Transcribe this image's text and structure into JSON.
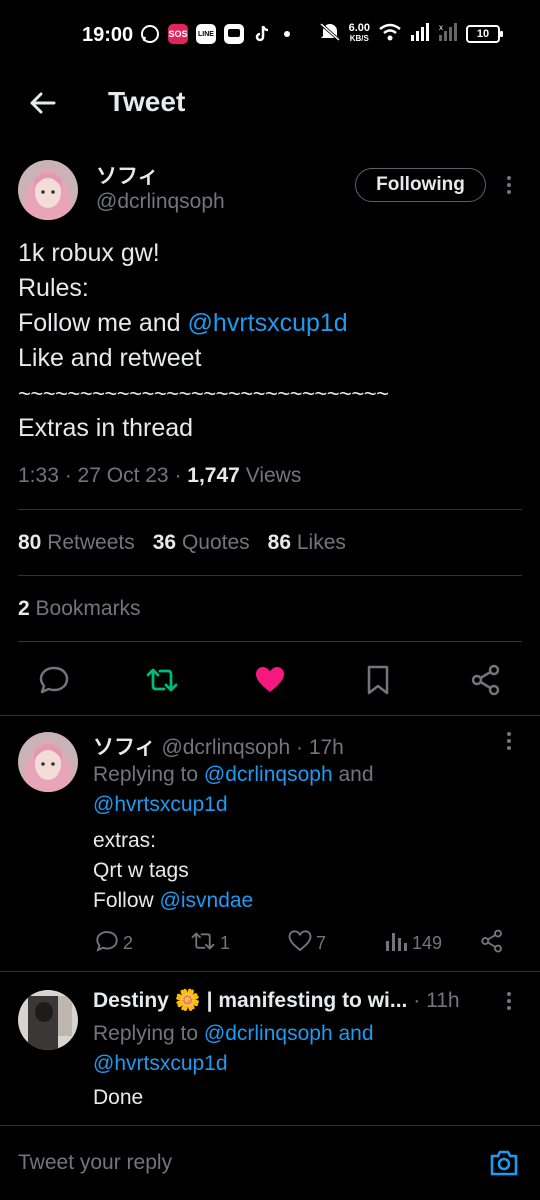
{
  "status_bar": {
    "time": "19:00",
    "net_speed_value": "6.00",
    "net_speed_unit": "KB/S",
    "battery": "10"
  },
  "header": {
    "title": "Tweet"
  },
  "main_tweet": {
    "author_name": "ソフィ",
    "author_handle": "@dcrlinqsoph",
    "follow_label": "Following",
    "lines": {
      "l1": "1k robux gw!",
      "l2": "Rules:",
      "l3_prefix": "Follow me and ",
      "l3_mention": "@hvrtsxcup1d",
      "l4": "Like and retweet",
      "l5": "~~~~~~~~~~~~~~~~~~~~~~~~~~~~~~",
      "l6": "Extras in thread"
    },
    "time": "1:33",
    "date": "27 Oct 23",
    "views_count": "1,747",
    "views_label": "Views",
    "retweets_count": "80",
    "retweets_label": "Retweets",
    "quotes_count": "36",
    "quotes_label": "Quotes",
    "likes_count": "86",
    "likes_label": "Likes",
    "bookmarks_count": "2",
    "bookmarks_label": "Bookmarks",
    "colors": {
      "retweet": "#00ba7c",
      "like": "#f91880",
      "link": "#1d9bf0"
    }
  },
  "replies": [
    {
      "name": "ソフィ",
      "handle": "@dcrlinqsoph",
      "age": "17h",
      "replying_label": "Replying to ",
      "replying_to_1": "@dcrlinqsoph",
      "and_label": " and",
      "replying_to_2": "@hvrtsxcup1d",
      "text_l1": "extras:",
      "text_l2": "Qrt w tags",
      "text_l3_prefix": "Follow ",
      "text_l3_mention": "@isvndae",
      "reply_count": "2",
      "retweet_count": "1",
      "like_count": "7",
      "view_count": "149"
    },
    {
      "name": "Destiny 🌼 | manifesting to wi...",
      "age": "11h",
      "replying_label": "Replying to ",
      "replying_to_1": "@dcrlinqsoph",
      "and_label": " and",
      "replying_to_2": "@hvrtsxcup1d",
      "text_l1": "Done"
    }
  ],
  "composer": {
    "placeholder": "Tweet your reply"
  }
}
